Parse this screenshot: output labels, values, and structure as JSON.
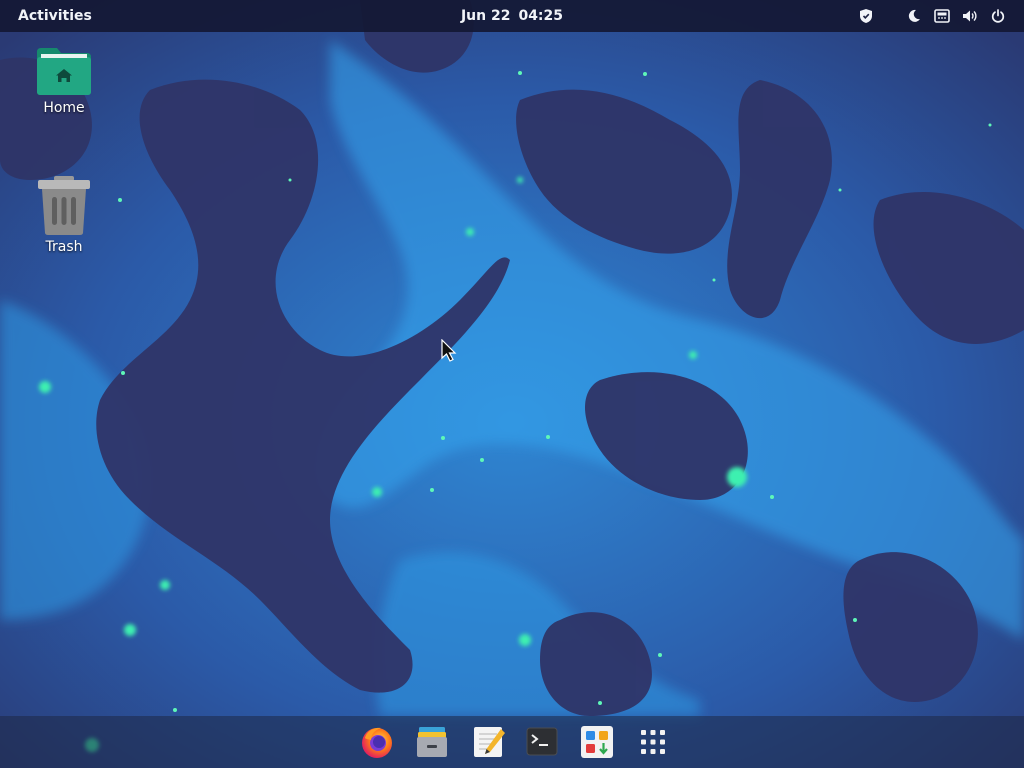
{
  "topbar": {
    "activities_label": "Activities",
    "date": "Jun 22",
    "time": "04:25",
    "status_icons": [
      "shield-icon",
      "night-light-icon",
      "network-icon",
      "volume-icon",
      "power-icon"
    ]
  },
  "desktop": {
    "icons": [
      {
        "label": "Home",
        "icon": "home-folder-icon",
        "color": "#1f9e80"
      },
      {
        "label": "Trash",
        "icon": "trash-icon",
        "color": "#8f8f8f"
      }
    ]
  },
  "dock": {
    "apps": [
      "firefox-icon",
      "files-icon",
      "text-editor-icon",
      "terminal-icon",
      "software-center-icon",
      "app-grid-icon"
    ]
  },
  "colors": {
    "topbar_bg": "#141834",
    "accent": "#1f9e80",
    "wallpaper_dark": "#2e3566",
    "wallpaper_light": "#2f8ad6",
    "glow": "#3df0b0"
  }
}
